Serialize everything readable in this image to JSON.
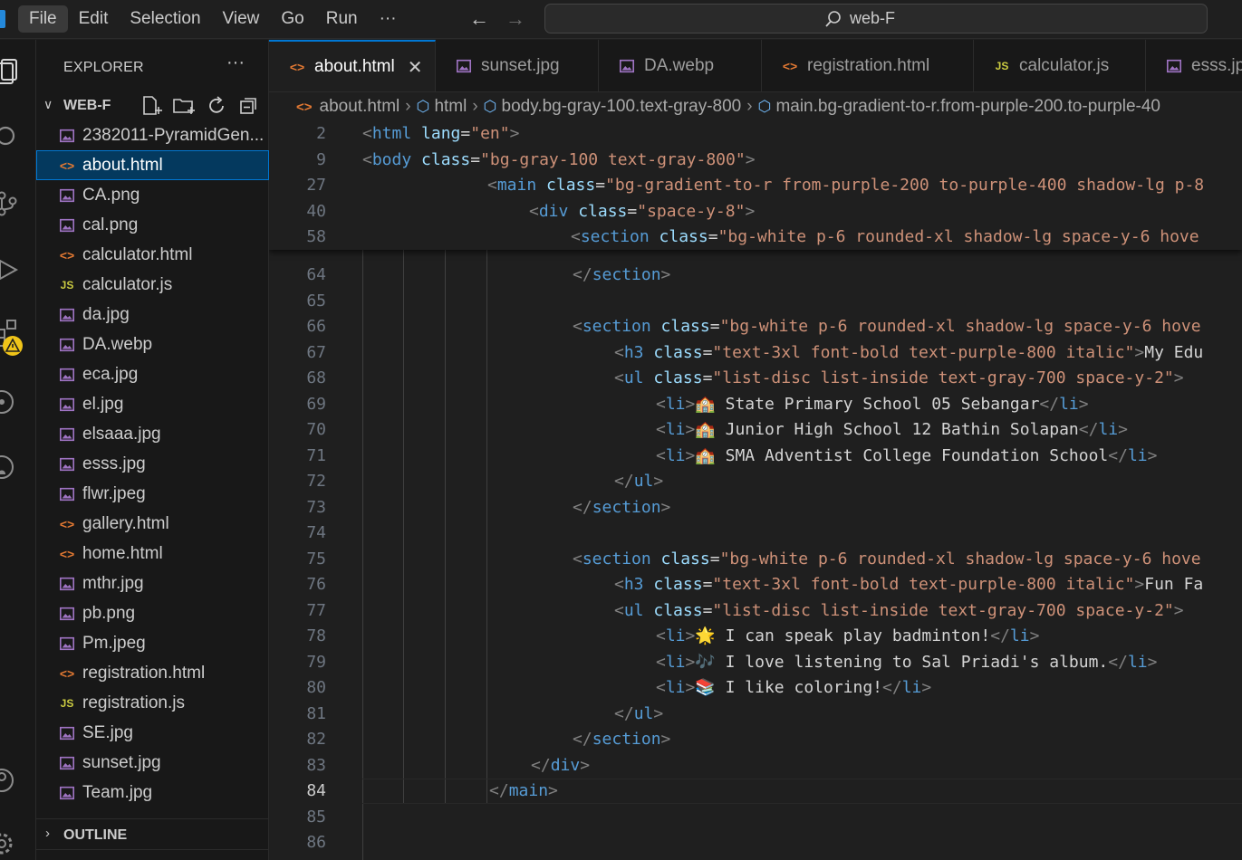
{
  "menu": [
    "File",
    "Edit",
    "Selection",
    "View",
    "Go",
    "Run",
    "···"
  ],
  "search": {
    "label": "web-F"
  },
  "explorer": {
    "title": "EXPLORER",
    "more": "···",
    "folder": "WEB-F",
    "files": [
      {
        "name": "2382011-PyramidGen...",
        "type": "img"
      },
      {
        "name": "about.html",
        "type": "html",
        "selected": true
      },
      {
        "name": "CA.png",
        "type": "img"
      },
      {
        "name": "cal.png",
        "type": "img"
      },
      {
        "name": "calculator.html",
        "type": "html"
      },
      {
        "name": "calculator.js",
        "type": "js"
      },
      {
        "name": "da.jpg",
        "type": "img"
      },
      {
        "name": "DA.webp",
        "type": "img"
      },
      {
        "name": "eca.jpg",
        "type": "img"
      },
      {
        "name": "el.jpg",
        "type": "img"
      },
      {
        "name": "elsaaa.jpg",
        "type": "img"
      },
      {
        "name": "esss.jpg",
        "type": "img"
      },
      {
        "name": "flwr.jpeg",
        "type": "img"
      },
      {
        "name": "gallery.html",
        "type": "html"
      },
      {
        "name": "home.html",
        "type": "html"
      },
      {
        "name": "mthr.jpg",
        "type": "img"
      },
      {
        "name": "pb.png",
        "type": "img"
      },
      {
        "name": "Pm.jpeg",
        "type": "img"
      },
      {
        "name": "registration.html",
        "type": "html"
      },
      {
        "name": "registration.js",
        "type": "js"
      },
      {
        "name": "SE.jpg",
        "type": "img"
      },
      {
        "name": "sunset.jpg",
        "type": "img"
      },
      {
        "name": "Team.jpg",
        "type": "img"
      }
    ],
    "outline": "OUTLINE"
  },
  "tabs": [
    {
      "label": "about.html",
      "type": "html",
      "active": true,
      "close": "✕"
    },
    {
      "label": "sunset.jpg",
      "type": "img"
    },
    {
      "label": "DA.webp",
      "type": "img"
    },
    {
      "label": "registration.html",
      "type": "html"
    },
    {
      "label": "calculator.js",
      "type": "js"
    },
    {
      "label": "esss.jpg",
      "type": "img"
    }
  ],
  "breadcrumb": {
    "file": "about.html",
    "html": "html",
    "body": "body.bg-gray-100.text-gray-800",
    "main": "main.bg-gradient-to-r.from-purple-200.to-purple-40"
  },
  "sticky_lines": [
    {
      "n": "2",
      "code": "<html lang=\"en\">"
    },
    {
      "n": "9",
      "code": "<body class=\"bg-gray-100 text-gray-800\">"
    },
    {
      "n": "27",
      "code": "<main class=\"bg-gradient-to-r from-purple-200 to-purple-400 shadow-lg p-8"
    },
    {
      "n": "40",
      "code": "<div class=\"space-y-8\">"
    },
    {
      "n": "58",
      "code": "<section class=\"bg-white p-6 rounded-xl shadow-lg space-y-6 hove"
    }
  ],
  "code_lines": [
    {
      "n": "64",
      "code": "</section>"
    },
    {
      "n": "65",
      "code": ""
    },
    {
      "n": "66",
      "code": "<section class=\"bg-white p-6 rounded-xl shadow-lg space-y-6 hove"
    },
    {
      "n": "67",
      "code": "<h3 class=\"text-3xl font-bold text-purple-800 italic\">My Edu"
    },
    {
      "n": "68",
      "code": "<ul class=\"list-disc list-inside text-gray-700 space-y-2\">"
    },
    {
      "n": "69",
      "code": "<li>🏫 State Primary School 05 Sebangar</li>"
    },
    {
      "n": "70",
      "code": "<li>🏫 Junior High School 12 Bathin Solapan</li>"
    },
    {
      "n": "71",
      "code": "<li>🏫 SMA Adventist College Foundation School</li>"
    },
    {
      "n": "72",
      "code": "</ul>"
    },
    {
      "n": "73",
      "code": "</section>"
    },
    {
      "n": "74",
      "code": ""
    },
    {
      "n": "75",
      "code": "<section class=\"bg-white p-6 rounded-xl shadow-lg space-y-6 hove"
    },
    {
      "n": "76",
      "code": "<h3 class=\"text-3xl font-bold text-purple-800 italic\">Fun Fa"
    },
    {
      "n": "77",
      "code": "<ul class=\"list-disc list-inside text-gray-700 space-y-2\">"
    },
    {
      "n": "78",
      "code": "<li>🌟 I can speak play badminton!</li>"
    },
    {
      "n": "79",
      "code": "<li>🎶 I love listening to Sal Priadi's album.</li>"
    },
    {
      "n": "80",
      "code": "<li>📚 I like coloring!</li>"
    },
    {
      "n": "81",
      "code": "</ul>"
    },
    {
      "n": "82",
      "code": "</section>"
    },
    {
      "n": "83",
      "code": "</div>"
    },
    {
      "n": "84",
      "code": "</main>",
      "current": true
    },
    {
      "n": "85",
      "code": ""
    },
    {
      "n": "86",
      "code": ""
    }
  ],
  "colors": {
    "accent": "#0078d4",
    "tag": "#569cd6",
    "attr": "#9cdcfe",
    "string": "#ce9178",
    "bracket": "#808080"
  }
}
